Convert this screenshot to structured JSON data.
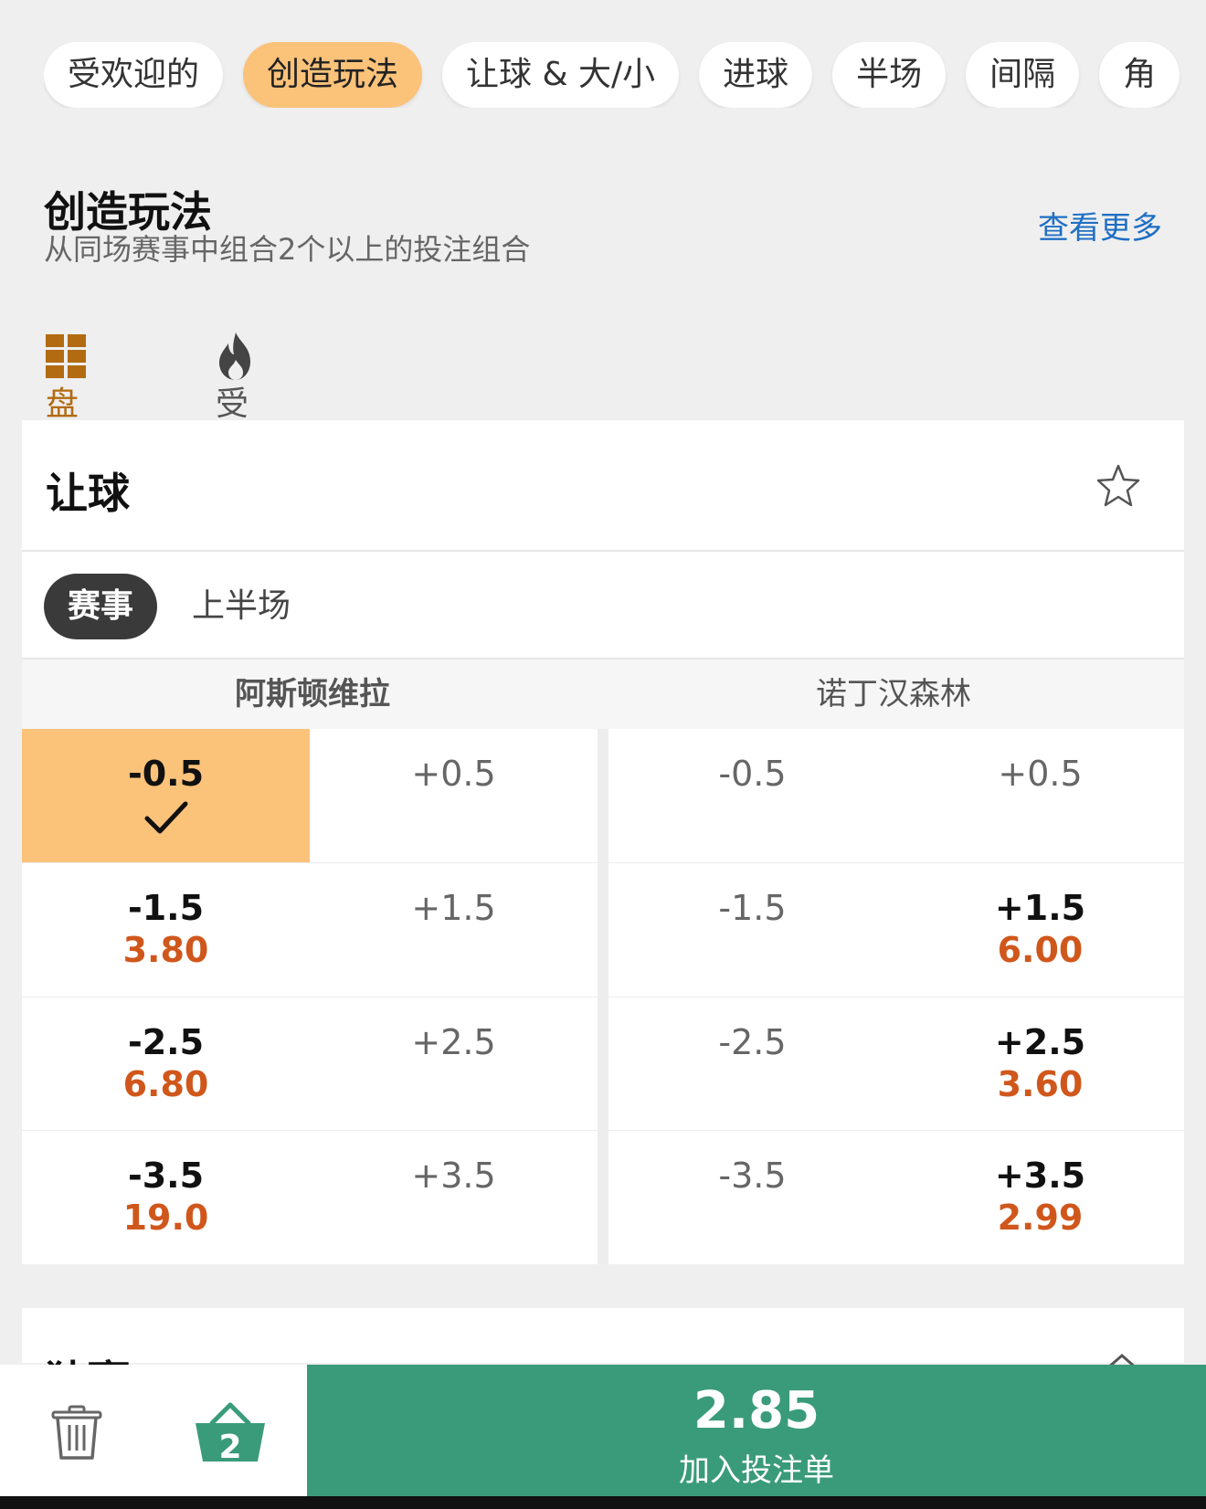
{
  "tabs": [
    {
      "label": "受欢迎的",
      "active": false
    },
    {
      "label": "创造玩法",
      "active": true
    },
    {
      "label": "让球 & 大/小",
      "active": false
    },
    {
      "label": "进球",
      "active": false
    },
    {
      "label": "半场",
      "active": false
    },
    {
      "label": "间隔",
      "active": false
    },
    {
      "label": "角",
      "active": false
    }
  ],
  "section": {
    "title": "创造玩法",
    "subtitle": "从同场赛事中组合2个以上的投注组合",
    "see_more": "查看更多"
  },
  "filters": {
    "markets": "盘口",
    "popular": "受欢迎的"
  },
  "market": {
    "title": "让球",
    "period_active": "赛事",
    "period_other": "上半场",
    "teams": [
      "阿斯顿维拉",
      "诺丁汉森林"
    ],
    "rows": [
      [
        {
          "line": "-0.5",
          "odds": "",
          "selected": true
        },
        {
          "line": "+0.5",
          "odds": ""
        },
        {
          "line": "-0.5",
          "odds": ""
        },
        {
          "line": "+0.5",
          "odds": ""
        }
      ],
      [
        {
          "line": "-1.5",
          "odds": "3.80"
        },
        {
          "line": "+1.5",
          "odds": ""
        },
        {
          "line": "-1.5",
          "odds": ""
        },
        {
          "line": "+1.5",
          "odds": "6.00"
        }
      ],
      [
        {
          "line": "-2.5",
          "odds": "6.80"
        },
        {
          "line": "+2.5",
          "odds": ""
        },
        {
          "line": "-2.5",
          "odds": ""
        },
        {
          "line": "+2.5",
          "odds": "3.60"
        }
      ],
      [
        {
          "line": "-3.5",
          "odds": "19.0"
        },
        {
          "line": "+3.5",
          "odds": ""
        },
        {
          "line": "-3.5",
          "odds": ""
        },
        {
          "line": "+3.5",
          "odds": "2.99"
        }
      ]
    ]
  },
  "next_market": {
    "title": "独赢"
  },
  "betslip": {
    "count": "2",
    "odds": "2.85",
    "label": "加入投注单"
  },
  "colors": {
    "accent": "#fbc27a",
    "odds": "#d0571c",
    "cta": "#3a9b7a",
    "link": "#1f6fc4"
  }
}
